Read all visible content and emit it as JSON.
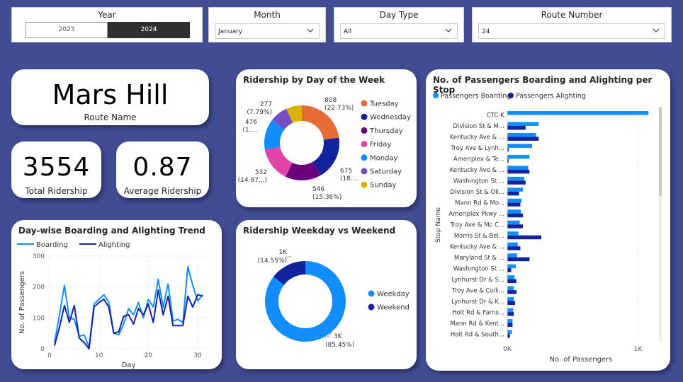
{
  "slicers": {
    "year": {
      "title": "Year",
      "options": [
        "2023",
        "2024"
      ],
      "selected": "2024"
    },
    "month": {
      "title": "Month",
      "value": "January"
    },
    "day_type": {
      "title": "Day Type",
      "value": "All"
    },
    "route_number": {
      "title": "Route Number",
      "value": "24"
    }
  },
  "route_card": {
    "value": "Mars Hill",
    "label": "Route Name"
  },
  "kpi_total": {
    "value": "3554",
    "label": "Total Ridership"
  },
  "kpi_average": {
    "value": "0.87",
    "label": "Average Ridership"
  },
  "colors": {
    "background": "#414c93",
    "boarding": "#118dff",
    "alighting": "#12239e",
    "tuesday": "#e66c37",
    "wednesday": "#12239e",
    "thursday": "#6b007b",
    "friday": "#e044a7",
    "monday": "#118dff",
    "saturday": "#744ec2",
    "sunday": "#d9b300"
  },
  "chart_data": [
    {
      "id": "day_of_week",
      "type": "pie",
      "title": "Ridership by Day of the Week",
      "donut": true,
      "legend_position": "right",
      "slices": [
        {
          "name": "Tuesday",
          "value": 808,
          "label": "808",
          "pct": "(22.73%)"
        },
        {
          "name": "Wednesday",
          "value": 675,
          "label": "675",
          "pct": "(18...."
        },
        {
          "name": "Thursday",
          "value": 546,
          "label": "546",
          "pct": "(15.36%)"
        },
        {
          "name": "Friday",
          "value": 532,
          "label": "532",
          "pct": "(14.97...)"
        },
        {
          "name": "Monday",
          "value": 476,
          "label": "476",
          "pct": "(1...."
        },
        {
          "name": "Saturday",
          "value": 277,
          "label": "277",
          "pct": "(7.79%)"
        },
        {
          "name": "Sunday",
          "value": 240,
          "label": "",
          "pct": ""
        }
      ]
    },
    {
      "id": "weekday_weekend",
      "type": "pie",
      "title": "Ridership Weekday vs Weekend",
      "donut": true,
      "legend_position": "right",
      "slices": [
        {
          "name": "Weekday",
          "value": 3037,
          "label": "3K",
          "pct": "(85.45%)"
        },
        {
          "name": "Weekend",
          "value": 517,
          "label": "1K",
          "pct": "(14.55%)"
        }
      ]
    },
    {
      "id": "day_trend",
      "type": "line",
      "title": "Day-wise Boarding and Alighting Trend",
      "xlabel": "Day",
      "ylabel": "No. of Passengers",
      "xlim": [
        0,
        32
      ],
      "ylim": [
        0,
        300
      ],
      "x_ticks": [
        "0",
        "10",
        "20",
        "30"
      ],
      "y_ticks": [
        "0",
        "100",
        "200",
        "300"
      ],
      "legend_position": "top-left",
      "x": [
        1,
        2,
        3,
        4,
        5,
        6,
        7,
        8,
        9,
        10,
        11,
        12,
        13,
        14,
        15,
        16,
        17,
        18,
        19,
        20,
        21,
        22,
        23,
        24,
        25,
        26,
        27,
        28,
        29,
        30,
        31
      ],
      "series": [
        {
          "name": "Boarding",
          "values": [
            20,
            110,
            205,
            100,
            95,
            40,
            45,
            5,
            145,
            160,
            175,
            150,
            50,
            45,
            80,
            130,
            110,
            150,
            100,
            160,
            135,
            225,
            135,
            210,
            90,
            95,
            85,
            265,
            205,
            155,
            175
          ]
        },
        {
          "name": "Alighting",
          "values": [
            10,
            70,
            140,
            85,
            140,
            35,
            20,
            0,
            135,
            150,
            160,
            135,
            50,
            55,
            105,
            110,
            80,
            130,
            110,
            145,
            85,
            190,
            110,
            170,
            75,
            75,
            75,
            170,
            135,
            175,
            170
          ]
        }
      ]
    },
    {
      "id": "per_stop",
      "type": "bar",
      "orientation": "horizontal",
      "title": "No. of Passengers Boarding and Alighting per Stop",
      "xlabel": "No. of Passengers",
      "ylabel": "Stop Name",
      "xlim": [
        0,
        1100
      ],
      "x_ticks": [
        "0K",
        "1K"
      ],
      "legend_position": "top-left",
      "categories": [
        "CTC-K",
        "Division St & M...",
        "Kentucky Ave & ...",
        "Troy Ave & Lynh...",
        "Ameriplex & Te...",
        "Kentucky Ave & ...",
        "Washington St ...",
        "Division St & Oli...",
        "Mann Rd & Mo...",
        "Ameriplex Pkwy ...",
        "Troy Ave & Mc C...",
        "Morris St & Bel...",
        "Kentucky Ave & ...",
        "Maryland St & ...",
        "Washington St ...",
        "Lynhurst Dr & S...",
        "Troy Ave & Colli...",
        "Lynhurst Dr & K...",
        "Holt Rd & Farns...",
        "Mann Rd & Kent...",
        "Holt Rd & South..."
      ],
      "series": [
        {
          "name": "Passengers Boarding",
          "values": [
            1080,
            240,
            220,
            190,
            170,
            160,
            130,
            120,
            110,
            105,
            95,
            85,
            80,
            75,
            65,
            55,
            50,
            50,
            45,
            40,
            35
          ]
        },
        {
          "name": "Passengers Alighting",
          "values": [
            0,
            140,
            240,
            10,
            10,
            170,
            140,
            90,
            100,
            120,
            120,
            260,
            100,
            170,
            30,
            70,
            70,
            60,
            50,
            40,
            20
          ]
        }
      ]
    }
  ]
}
